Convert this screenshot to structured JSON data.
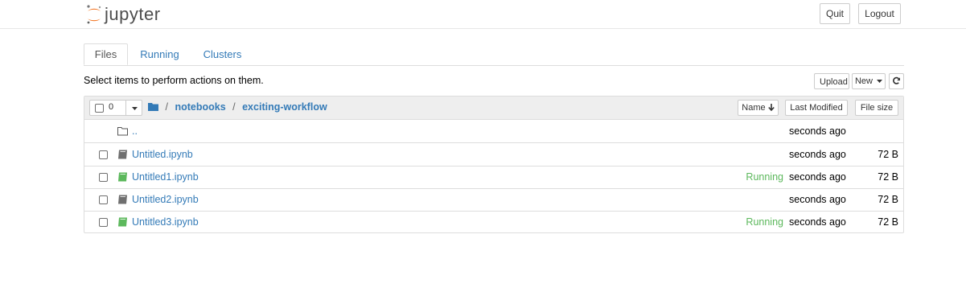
{
  "header": {
    "logo_text": "jupyter",
    "quit_label": "Quit",
    "logout_label": "Logout",
    "brand_color": "#F37726"
  },
  "tabs": [
    {
      "label": "Files",
      "active": true
    },
    {
      "label": "Running",
      "active": false
    },
    {
      "label": "Clusters",
      "active": false
    }
  ],
  "notice": "Select items to perform actions on them.",
  "toolbar": {
    "upload_label": "Upload",
    "new_label": "New",
    "refresh_icon": "refresh-icon"
  },
  "list_header": {
    "selected_count": "0",
    "breadcrumb": {
      "root_icon": "folder-icon",
      "separator": "/",
      "items": [
        "notebooks",
        "exciting-workflow"
      ]
    },
    "sort_name_label": "Name",
    "sort_modified_label": "Last Modified",
    "sort_size_label": "File size"
  },
  "items": [
    {
      "name": "..",
      "type": "folder",
      "status": "",
      "modified": "seconds ago",
      "size": ""
    },
    {
      "name": "Untitled.ipynb",
      "type": "notebook",
      "status": "",
      "modified": "seconds ago",
      "size": "72 B"
    },
    {
      "name": "Untitled1.ipynb",
      "type": "notebook",
      "status": "Running",
      "modified": "seconds ago",
      "size": "72 B"
    },
    {
      "name": "Untitled2.ipynb",
      "type": "notebook",
      "status": "",
      "modified": "seconds ago",
      "size": "72 B"
    },
    {
      "name": "Untitled3.ipynb",
      "type": "notebook",
      "status": "Running",
      "modified": "seconds ago",
      "size": "72 B"
    }
  ],
  "colors": {
    "link": "#337ab7",
    "running": "#5cb85c",
    "notebook_idle": "#6f6f6f",
    "notebook_running": "#5cb85c"
  }
}
